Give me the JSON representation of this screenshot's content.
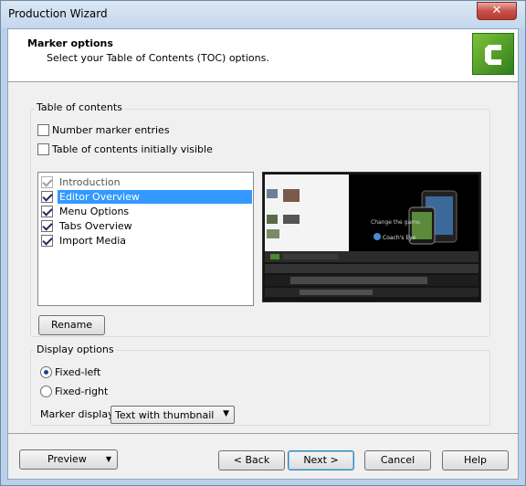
{
  "window": {
    "title": "Production Wizard",
    "close_glyph": "✕"
  },
  "header": {
    "title": "Marker options",
    "subtitle": "Select your Table of Contents (TOC) options.",
    "logo_icon": "camtasia-logo-icon"
  },
  "toc_group": {
    "label": "Table of contents",
    "number_marker_entries": {
      "label": "Number marker entries",
      "checked": false
    },
    "toc_initially_visible": {
      "label": "Table of contents initially visible",
      "checked": false
    },
    "markers": [
      {
        "label": "Introduction",
        "checked": true,
        "disabled": true,
        "selected": false
      },
      {
        "label": "Editor Overview",
        "checked": true,
        "disabled": false,
        "selected": true
      },
      {
        "label": "Menu Options",
        "checked": true,
        "disabled": false,
        "selected": false
      },
      {
        "label": "Tabs Overview",
        "checked": true,
        "disabled": false,
        "selected": false
      },
      {
        "label": "Import Media",
        "checked": true,
        "disabled": false,
        "selected": false
      }
    ],
    "rename_label": "Rename"
  },
  "display_group": {
    "label": "Display options",
    "fixed_left": {
      "label": "Fixed-left",
      "selected": true
    },
    "fixed_right": {
      "label": "Fixed-right",
      "selected": false
    },
    "marker_display_label": "Marker display:",
    "marker_display_value": "Text with thumbnail"
  },
  "footer": {
    "preview_label": "Preview",
    "back_label": "< Back",
    "next_label": "Next >",
    "cancel_label": "Cancel",
    "help_label": "Help"
  },
  "preview_image": {
    "caption_text": "Change the game.",
    "brand_text": "Coach's Eye"
  }
}
